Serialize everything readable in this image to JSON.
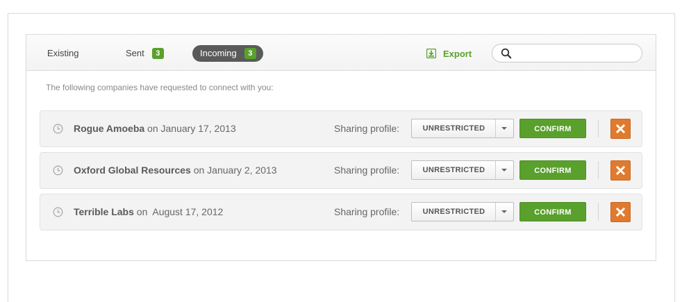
{
  "tabs": {
    "existing": "Existing",
    "sent": "Sent",
    "sent_count": "3",
    "incoming": "Incoming",
    "incoming_count": "3",
    "active": "incoming"
  },
  "export_label": "Export",
  "search": {
    "placeholder": "",
    "value": ""
  },
  "intro_text": "The following companies have requested to connect with you:",
  "requests": [
    {
      "company": "Rogue Amoeba",
      "date_text": " on January 17, 2013",
      "sharing_label": "Sharing profile:",
      "profile": "UNRESTRICTED",
      "confirm_label": "CONFIRM"
    },
    {
      "company": "Oxford Global Resources",
      "date_text": " on January 2, 2013",
      "sharing_label": "Sharing profile:",
      "profile": "UNRESTRICTED",
      "confirm_label": "CONFIRM"
    },
    {
      "company": "Terrible Labs",
      "date_text": " on  August 17, 2012",
      "sharing_label": "Sharing profile:",
      "profile": "UNRESTRICTED",
      "confirm_label": "CONFIRM"
    }
  ],
  "colors": {
    "accent_green": "#5aa02c",
    "reject_orange": "#e07a2e",
    "active_tab": "#5a5a5a"
  },
  "icons": [
    "export-icon",
    "search-icon",
    "clock-icon",
    "chevron-down-icon",
    "close-icon"
  ]
}
